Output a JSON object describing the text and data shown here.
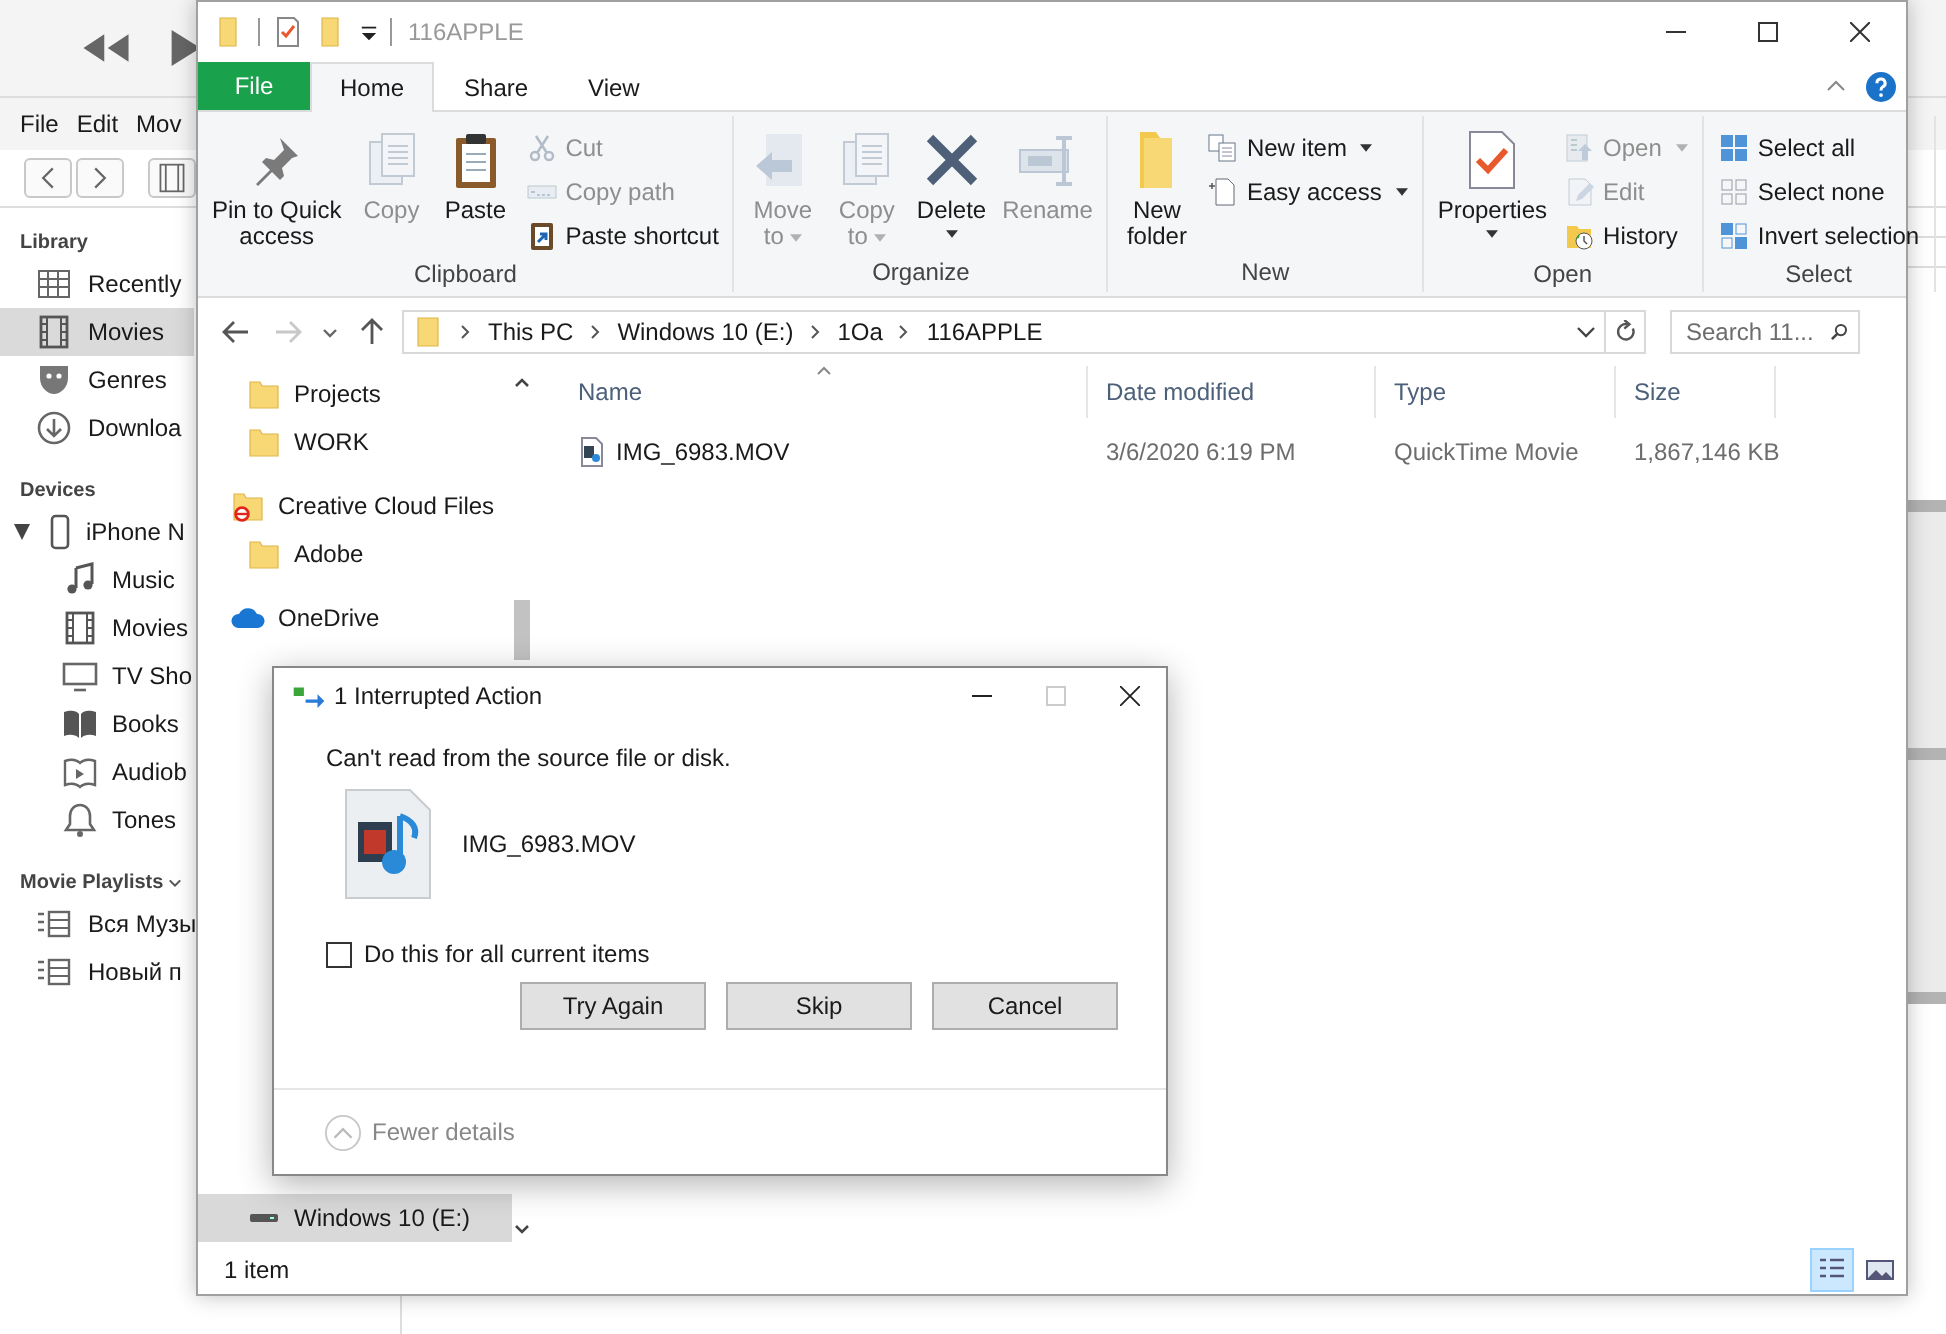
{
  "itunes": {
    "menu": [
      {
        "label": "File"
      },
      {
        "label": "Edit"
      },
      {
        "label": "Mov"
      }
    ],
    "sidebar": [
      {
        "heading": "Library",
        "chevron": false,
        "items": [
          {
            "label": "Recently",
            "kind": "recent",
            "selected": false
          },
          {
            "label": "Movies",
            "kind": "film",
            "selected": true
          },
          {
            "label": "Genres",
            "kind": "genres",
            "selected": false
          },
          {
            "label": "Downloa",
            "kind": "download",
            "selected": false
          }
        ]
      },
      {
        "heading": "Devices",
        "chevron": false,
        "items": [
          {
            "label": "iPhone N",
            "kind": "phone",
            "selected": false,
            "expanded": true,
            "children": [
              {
                "label": "Music",
                "kind": "music",
                "selected": false
              },
              {
                "label": "Movies",
                "kind": "film",
                "selected": false
              },
              {
                "label": "TV Sho",
                "kind": "tv",
                "selected": false
              },
              {
                "label": "Books",
                "kind": "books",
                "selected": false
              },
              {
                "label": "Audiob",
                "kind": "audiobook",
                "selected": false
              },
              {
                "label": "Tones",
                "kind": "tones",
                "selected": false
              }
            ]
          }
        ]
      },
      {
        "heading": "Movie Playlists",
        "chevron": true,
        "items": [
          {
            "label": "Вся Музы",
            "kind": "playlist",
            "selected": false
          },
          {
            "label": "Новый п",
            "kind": "playlist",
            "selected": false
          }
        ]
      }
    ]
  },
  "explorer": {
    "title": "116APPLE",
    "tabs": [
      {
        "label": "File",
        "kind": "file",
        "selected": false
      },
      {
        "label": "Home",
        "kind": "tab",
        "selected": true
      },
      {
        "label": "Share",
        "kind": "tab",
        "selected": false
      },
      {
        "label": "View",
        "kind": "tab",
        "selected": false
      }
    ],
    "ribbon": [
      {
        "label": "Clipboard",
        "buttons": [
          {
            "label": "Pin to Quick\naccess",
            "kind": "large",
            "disabled": false,
            "dropdown": false
          },
          {
            "label": "Copy",
            "kind": "large",
            "disabled": true,
            "dropdown": false
          },
          {
            "label": "Paste",
            "kind": "large",
            "disabled": false,
            "dropdown": false
          },
          {
            "label": "Cut",
            "kind": "small",
            "disabled": true,
            "dropdown": false
          },
          {
            "label": "Copy path",
            "kind": "small",
            "disabled": true,
            "dropdown": false
          },
          {
            "label": "Paste shortcut",
            "kind": "small",
            "disabled": false,
            "dropdown": false
          }
        ]
      },
      {
        "label": "Organize",
        "buttons": [
          {
            "label": "Move\nto",
            "kind": "large",
            "disabled": true,
            "dropdown": true
          },
          {
            "label": "Copy\nto",
            "kind": "large",
            "disabled": true,
            "dropdown": true
          },
          {
            "label": "Delete",
            "kind": "large",
            "disabled": false,
            "dropdown": true
          },
          {
            "label": "Rename",
            "kind": "large",
            "disabled": true,
            "dropdown": false
          }
        ]
      },
      {
        "label": "New",
        "buttons": [
          {
            "label": "New\nfolder",
            "kind": "large",
            "disabled": false,
            "dropdown": false
          },
          {
            "label": "New item",
            "kind": "small",
            "disabled": false,
            "dropdown": true
          },
          {
            "label": "Easy access",
            "kind": "small",
            "disabled": false,
            "dropdown": true
          }
        ]
      },
      {
        "label": "Open",
        "buttons": [
          {
            "label": "Properties",
            "kind": "large",
            "disabled": false,
            "dropdown": true
          },
          {
            "label": "Open",
            "kind": "small",
            "disabled": true,
            "dropdown": true
          },
          {
            "label": "Edit",
            "kind": "small",
            "disabled": true,
            "dropdown": false
          },
          {
            "label": "History",
            "kind": "small",
            "disabled": false,
            "dropdown": false
          }
        ]
      },
      {
        "label": "Select",
        "buttons": [
          {
            "label": "Select all",
            "kind": "small",
            "disabled": false,
            "dropdown": false
          },
          {
            "label": "Select none",
            "kind": "small",
            "disabled": false,
            "dropdown": false
          },
          {
            "label": "Invert selection",
            "kind": "small",
            "disabled": false,
            "dropdown": false
          }
        ]
      }
    ],
    "nav_buttons": [
      {
        "kind": "back",
        "disabled": false
      },
      {
        "kind": "forward",
        "disabled": true
      },
      {
        "kind": "recent",
        "disabled": false
      },
      {
        "kind": "up",
        "disabled": false
      }
    ],
    "path": [
      "This PC",
      "Windows 10 (E:)",
      "1Oa",
      "116APPLE"
    ],
    "search": {
      "placeholder": "Search 11..."
    },
    "nav_pane": [
      {
        "label": "Projects",
        "kind": "folder",
        "selected": false
      },
      {
        "label": "WORK",
        "kind": "folder",
        "selected": false
      },
      {
        "label": "Creative Cloud Files",
        "kind": "cc-folder",
        "selected": false,
        "children": [
          {
            "label": "Adobe",
            "kind": "folder",
            "selected": false
          }
        ]
      },
      {
        "label": "OneDrive",
        "kind": "cloud",
        "selected": false
      },
      {
        "label": "Windows 10 (E:)",
        "kind": "drive",
        "selected": true
      }
    ],
    "columns": [
      {
        "label": "Name",
        "sorted": true
      },
      {
        "label": "Date modified",
        "sorted": false
      },
      {
        "label": "Type",
        "sorted": false
      },
      {
        "label": "Size",
        "sorted": false
      }
    ],
    "rows": [
      {
        "selected": false,
        "cells": [
          "IMG_6983.MOV",
          "3/6/2020 6:19 PM",
          "QuickTime Movie",
          "1,867,146 KB"
        ]
      }
    ],
    "status": "1 item",
    "views": [
      {
        "kind": "details",
        "selected": true
      },
      {
        "kind": "large-icons",
        "selected": false
      }
    ]
  },
  "dialog": {
    "title": "1 Interrupted Action",
    "message": "Can't read from the source file or disk.",
    "file": "IMG_6983.MOV",
    "option": {
      "label": "Do this for all current items",
      "checked": false
    },
    "buttons": [
      {
        "label": "Try Again"
      },
      {
        "label": "Skip"
      },
      {
        "label": "Cancel"
      }
    ],
    "details": {
      "label": "Fewer details",
      "expanded": true
    }
  }
}
